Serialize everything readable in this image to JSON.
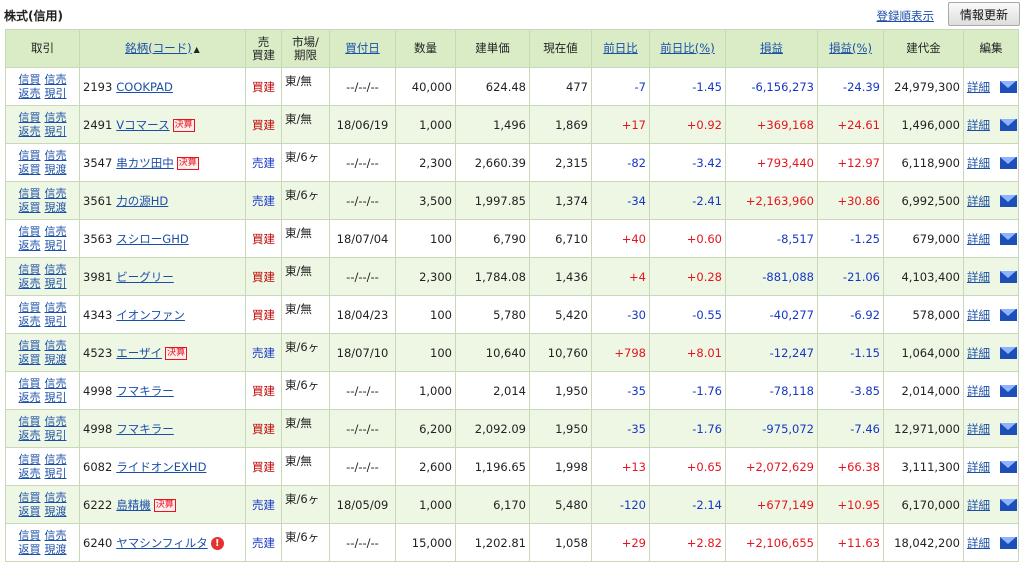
{
  "header": {
    "title": "株式(信用)",
    "register_link": "登録順表示",
    "refresh_button": "情報更新"
  },
  "columns": {
    "trade": "取引",
    "stock": "銘柄(コード)",
    "sort_indicator": "▲",
    "side_l1": "売",
    "side_l2": "買建",
    "market_l1": "市場/",
    "market_l2": "期限",
    "buy_date": "買付日",
    "quantity": "数量",
    "entry_price": "建単価",
    "current_price": "現在値",
    "prev_diff": "前日比",
    "prev_diff_pct": "前日比(%)",
    "pl": "損益",
    "pl_pct": "損益(%)",
    "position_value": "建代金",
    "edit": "編集"
  },
  "icons": {
    "sort": "triangle-up-icon",
    "mail": "mail-envelope-icon",
    "alert": "exclamation-alert-icon"
  },
  "colors": {
    "positive": "#e6141e",
    "negative": "#1537c4",
    "header_bg": "#d9ecc6",
    "alt_row_bg": "#eef7e4",
    "link": "#1a4fa8"
  },
  "rows": [
    {
      "actions": [
        "信買",
        "信売",
        "返売",
        "現引"
      ],
      "code": "2193",
      "name": "COOKPAD",
      "badge": "",
      "alert": false,
      "side": "買建",
      "market": "東/無",
      "date": "--/--/--",
      "qty": "40,000",
      "entry": "624.48",
      "current": "477",
      "diff": "-7",
      "diff_pct": "-1.45",
      "pl": "-6,156,273",
      "pl_pct": "-24.39",
      "value": "24,979,300",
      "detail": "詳細"
    },
    {
      "actions": [
        "信買",
        "信売",
        "返売",
        "現引"
      ],
      "code": "2491",
      "name": "Vコマース",
      "badge": "決算",
      "alert": false,
      "side": "買建",
      "market": "東/無",
      "date": "18/06/19",
      "qty": "1,000",
      "entry": "1,496",
      "current": "1,869",
      "diff": "+17",
      "diff_pct": "+0.92",
      "pl": "+369,168",
      "pl_pct": "+24.61",
      "value": "1,496,000",
      "detail": "詳細"
    },
    {
      "actions": [
        "信買",
        "信売",
        "返買",
        "現渡"
      ],
      "code": "3547",
      "name": "串カツ田中",
      "badge": "決算",
      "alert": false,
      "side": "売建",
      "market": "東/6ヶ",
      "date": "--/--/--",
      "qty": "2,300",
      "entry": "2,660.39",
      "current": "2,315",
      "diff": "-82",
      "diff_pct": "-3.42",
      "pl": "+793,440",
      "pl_pct": "+12.97",
      "value": "6,118,900",
      "detail": "詳細"
    },
    {
      "actions": [
        "信買",
        "信売",
        "返買",
        "現渡"
      ],
      "code": "3561",
      "name": "力の源HD",
      "badge": "",
      "alert": false,
      "side": "売建",
      "market": "東/6ヶ",
      "date": "--/--/--",
      "qty": "3,500",
      "entry": "1,997.85",
      "current": "1,374",
      "diff": "-34",
      "diff_pct": "-2.41",
      "pl": "+2,163,960",
      "pl_pct": "+30.86",
      "value": "6,992,500",
      "detail": "詳細"
    },
    {
      "actions": [
        "信買",
        "信売",
        "返売",
        "現引"
      ],
      "code": "3563",
      "name": "スシローGHD",
      "badge": "",
      "alert": false,
      "side": "買建",
      "market": "東/無",
      "date": "18/07/04",
      "qty": "100",
      "entry": "6,790",
      "current": "6,710",
      "diff": "+40",
      "diff_pct": "+0.60",
      "pl": "-8,517",
      "pl_pct": "-1.25",
      "value": "679,000",
      "detail": "詳細"
    },
    {
      "actions": [
        "信買",
        "信売",
        "返売",
        "現引"
      ],
      "code": "3981",
      "name": "ビーグリー",
      "badge": "",
      "alert": false,
      "side": "買建",
      "market": "東/無",
      "date": "--/--/--",
      "qty": "2,300",
      "entry": "1,784.08",
      "current": "1,436",
      "diff": "+4",
      "diff_pct": "+0.28",
      "pl": "-881,088",
      "pl_pct": "-21.06",
      "value": "4,103,400",
      "detail": "詳細"
    },
    {
      "actions": [
        "信買",
        "信売",
        "返売",
        "現引"
      ],
      "code": "4343",
      "name": "イオンファン",
      "badge": "",
      "alert": false,
      "side": "買建",
      "market": "東/無",
      "date": "18/04/23",
      "qty": "100",
      "entry": "5,780",
      "current": "5,420",
      "diff": "-30",
      "diff_pct": "-0.55",
      "pl": "-40,277",
      "pl_pct": "-6.92",
      "value": "578,000",
      "detail": "詳細"
    },
    {
      "actions": [
        "信買",
        "信売",
        "返買",
        "現渡"
      ],
      "code": "4523",
      "name": "エーザイ",
      "badge": "決算",
      "alert": false,
      "side": "売建",
      "market": "東/6ヶ",
      "date": "18/07/10",
      "qty": "100",
      "entry": "10,640",
      "current": "10,760",
      "diff": "+798",
      "diff_pct": "+8.01",
      "pl": "-12,247",
      "pl_pct": "-1.15",
      "value": "1,064,000",
      "detail": "詳細"
    },
    {
      "actions": [
        "信買",
        "信売",
        "返売",
        "現引"
      ],
      "code": "4998",
      "name": "フマキラー",
      "badge": "",
      "alert": false,
      "side": "買建",
      "market": "東/6ヶ",
      "date": "--/--/--",
      "qty": "1,000",
      "entry": "2,014",
      "current": "1,950",
      "diff": "-35",
      "diff_pct": "-1.76",
      "pl": "-78,118",
      "pl_pct": "-3.85",
      "value": "2,014,000",
      "detail": "詳細"
    },
    {
      "actions": [
        "信買",
        "信売",
        "返売",
        "現引"
      ],
      "code": "4998",
      "name": "フマキラー",
      "badge": "",
      "alert": false,
      "side": "買建",
      "market": "東/無",
      "date": "--/--/--",
      "qty": "6,200",
      "entry": "2,092.09",
      "current": "1,950",
      "diff": "-35",
      "diff_pct": "-1.76",
      "pl": "-975,072",
      "pl_pct": "-7.46",
      "value": "12,971,000",
      "detail": "詳細"
    },
    {
      "actions": [
        "信買",
        "信売",
        "返売",
        "現引"
      ],
      "code": "6082",
      "name": "ライドオンEXHD",
      "badge": "",
      "alert": false,
      "side": "買建",
      "market": "東/無",
      "date": "--/--/--",
      "qty": "2,600",
      "entry": "1,196.65",
      "current": "1,998",
      "diff": "+13",
      "diff_pct": "+0.65",
      "pl": "+2,072,629",
      "pl_pct": "+66.38",
      "value": "3,111,300",
      "detail": "詳細"
    },
    {
      "actions": [
        "信買",
        "信売",
        "返買",
        "現渡"
      ],
      "code": "6222",
      "name": "島精機",
      "badge": "決算",
      "alert": false,
      "side": "売建",
      "market": "東/6ヶ",
      "date": "18/05/09",
      "qty": "1,000",
      "entry": "6,170",
      "current": "5,480",
      "diff": "-120",
      "diff_pct": "-2.14",
      "pl": "+677,149",
      "pl_pct": "+10.95",
      "value": "6,170,000",
      "detail": "詳細"
    },
    {
      "actions": [
        "信買",
        "信売",
        "返買",
        "現渡"
      ],
      "code": "6240",
      "name": "ヤマシンフィルタ",
      "badge": "",
      "alert": true,
      "side": "売建",
      "market": "東/6ヶ",
      "date": "--/--/--",
      "qty": "15,000",
      "entry": "1,202.81",
      "current": "1,058",
      "diff": "+29",
      "diff_pct": "+2.82",
      "pl": "+2,106,655",
      "pl_pct": "+11.63",
      "value": "18,042,200",
      "detail": "詳細"
    }
  ]
}
